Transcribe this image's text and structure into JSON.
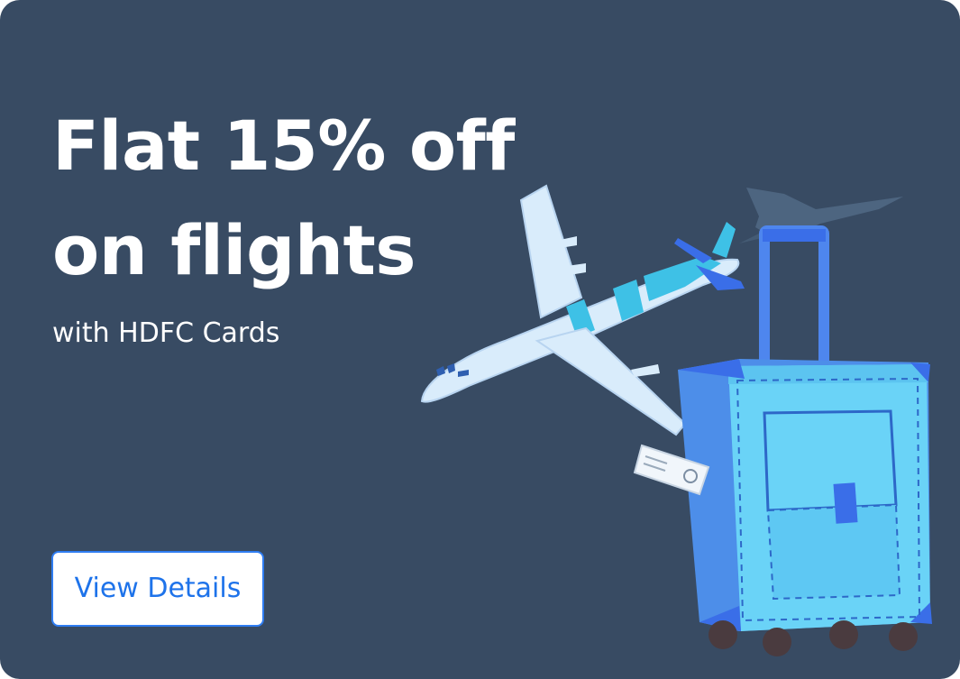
{
  "offer": {
    "headline_line1": "Flat 15% off",
    "headline_line2": "on flights",
    "subtitle": "with HDFC Cards",
    "cta_label": "View Details"
  },
  "illustration": {
    "items": [
      "airplane-icon",
      "plane-shadow-icon",
      "suitcase-icon",
      "luggage-tag-icon"
    ]
  },
  "colors": {
    "background": "#384b63",
    "text": "#ffffff",
    "cta_text": "#1e73ea",
    "cta_border": "#2f7df2",
    "plane_body": "#d9ecfb",
    "plane_stripe": "#3ec1e6",
    "suitcase": "#6ad3f7",
    "suitcase_trim": "#3a6ee8"
  }
}
